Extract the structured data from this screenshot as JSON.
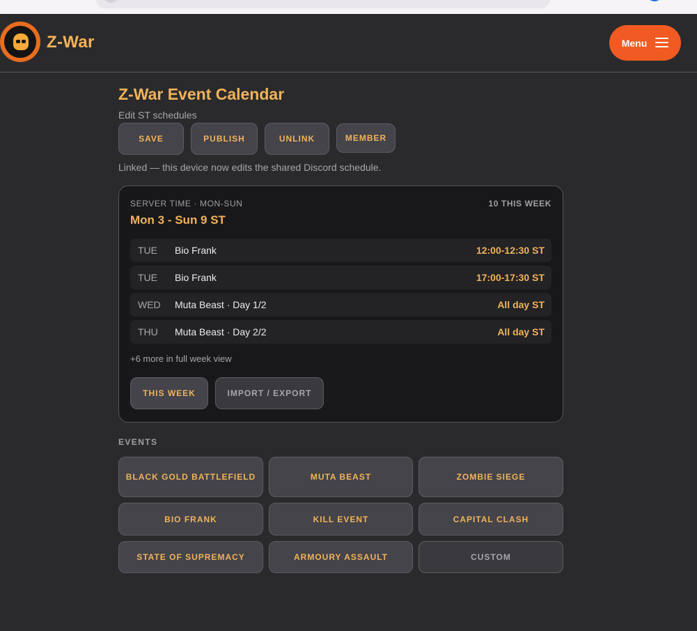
{
  "header": {
    "brand": "Z-War",
    "menu_label": "Menu"
  },
  "page": {
    "title": "Z-War Event Calendar",
    "subtitle": "Edit ST schedules",
    "actions": {
      "save": "SAVE",
      "publish": "PUBLISH",
      "unlink": "UNLINK",
      "member": "MEMBER"
    },
    "status": "Linked — this device now edits the shared Discord schedule."
  },
  "week": {
    "label": "SERVER TIME · MON-SUN",
    "count": "10 THIS WEEK",
    "range": "Mon 3 - Sun 9 ST",
    "events": [
      {
        "day": "TUE",
        "name": "Bio Frank",
        "time": "12:00-12:30 ST"
      },
      {
        "day": "TUE",
        "name": "Bio Frank",
        "time": "17:00-17:30 ST"
      },
      {
        "day": "WED",
        "name": "Muta Beast · Day 1/2",
        "time": "All day ST"
      },
      {
        "day": "THU",
        "name": "Muta Beast · Day 2/2",
        "time": "All day ST"
      }
    ],
    "more": "+6 more in full week view",
    "this_week_button": "THIS WEEK",
    "import_export_button": "IMPORT / EXPORT"
  },
  "events_section": {
    "label": "EVENTS",
    "buttons": [
      "BLACK GOLD BATTLEFIELD",
      "MUTA BEAST",
      "ZOMBIE SIEGE",
      "BIO FRANK",
      "KILL EVENT",
      "CAPITAL CLASH",
      "STATE OF SUPREMACY",
      "ARMOURY ASSAULT",
      "CUSTOM"
    ]
  },
  "colors": {
    "accent": "#f1b35a",
    "menu": "#f15a22",
    "background": "#2a2a2c",
    "card": "#18181a"
  }
}
